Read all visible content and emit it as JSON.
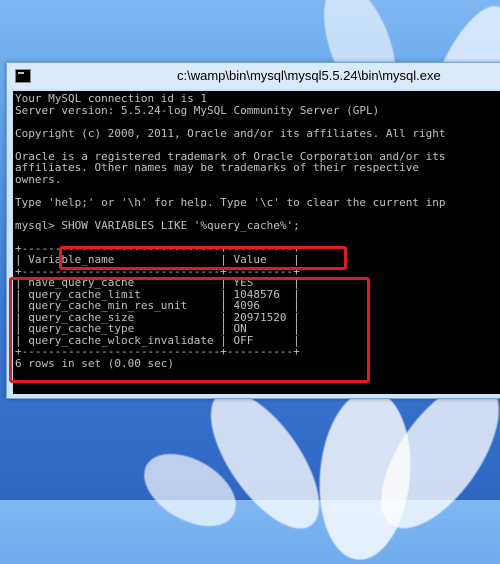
{
  "window": {
    "title": "c:\\wamp\\bin\\mysql\\mysql5.5.24\\bin\\mysql.exe"
  },
  "console": {
    "intro": [
      "Your MySQL connection id is 1",
      "Server version: 5.5.24-log MySQL Community Server (GPL)",
      "",
      "Copyright (c) 2000, 2011, Oracle and/or its affiliates. All right",
      "",
      "Oracle is a registered trademark of Oracle Corporation and/or its",
      "affiliates. Other names may be trademarks of their respective",
      "owners.",
      "",
      "Type 'help;' or '\\h' for help. Type '\\c' to clear the current inp",
      ""
    ],
    "prompt": "mysql> ",
    "command": "SHOW VARIABLES LIKE '%query_cache%';",
    "table_border": "+------------------------------+----------+",
    "table_header": "| Variable_name                | Value    |",
    "rows": [
      "| have_query_cache             | YES      |",
      "| query_cache_limit            | 1048576  |",
      "| query_cache_min_res_unit     | 4096     |",
      "| query_cache_size             | 20971520 |",
      "| query_cache_type             | ON       |",
      "| query_cache_wlock_invalidate | OFF      |"
    ],
    "result_summary": "6 rows in set (0.00 sec)"
  },
  "colors": {
    "highlight": "#e11b22",
    "console_bg": "#000000",
    "console_fg": "#c0c0c0"
  }
}
